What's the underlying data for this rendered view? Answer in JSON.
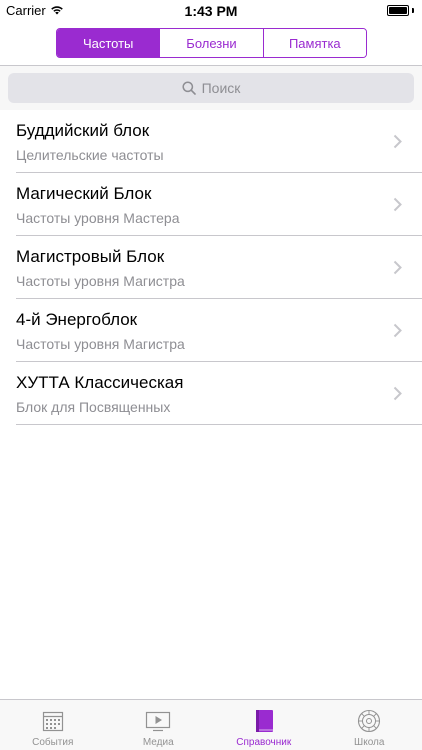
{
  "status": {
    "carrier": "Carrier",
    "time": "1:43 PM"
  },
  "segments": [
    {
      "label": "Частоты",
      "active": true
    },
    {
      "label": "Болезни",
      "active": false
    },
    {
      "label": "Памятка",
      "active": false
    }
  ],
  "search": {
    "placeholder": "Поиск"
  },
  "list": [
    {
      "title": "Буддийский блок",
      "subtitle": "Целительские частоты"
    },
    {
      "title": "Магический Блок",
      "subtitle": "Частоты уровня Мастера"
    },
    {
      "title": "Магистровый Блок",
      "subtitle": "Частоты уровня Магистра"
    },
    {
      "title": "4-й Энергоблок",
      "subtitle": "Частоты уровня Магистра"
    },
    {
      "title": "ХУТТА Классическая",
      "subtitle": "Блок для Посвященных"
    }
  ],
  "tabs": [
    {
      "label": "События",
      "icon": "calendar-icon",
      "active": false
    },
    {
      "label": "Медиа",
      "icon": "play-icon",
      "active": false
    },
    {
      "label": "Справочник",
      "icon": "book-icon",
      "active": true
    },
    {
      "label": "Школа",
      "icon": "mandala-icon",
      "active": false
    }
  ],
  "colors": {
    "accent": "#9a2bd0",
    "inactive_tab": "#929292",
    "subtitle": "#8e8e93"
  }
}
